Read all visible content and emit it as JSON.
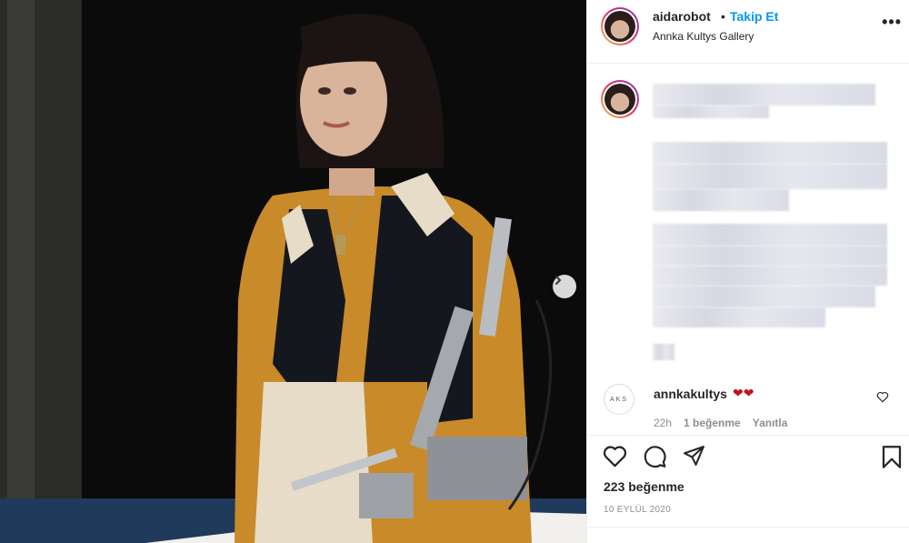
{
  "header": {
    "username": "aidarobot",
    "separator": "•",
    "follow_label": "Takip Et",
    "location": "Annka Kultys Gallery",
    "more_label": "•••"
  },
  "comment": {
    "avatar_text": "AKS",
    "username": "annkakultys",
    "text": "❤❤",
    "time": "22h",
    "likes": "1 beğenme",
    "reply_label": "Yanıtla"
  },
  "post": {
    "likes_text": "223 beğenme",
    "date": "10 EYLÜL 2020"
  },
  "icons": {
    "like": "heart-icon",
    "comment": "comment-icon",
    "share": "paper-plane-icon",
    "save": "bookmark-icon",
    "next": "chevron-right-icon"
  },
  "colors": {
    "follow": "#0095f6",
    "heart_emoji": "#c1121f",
    "text": "#262626",
    "muted": "#8e8e8e"
  }
}
